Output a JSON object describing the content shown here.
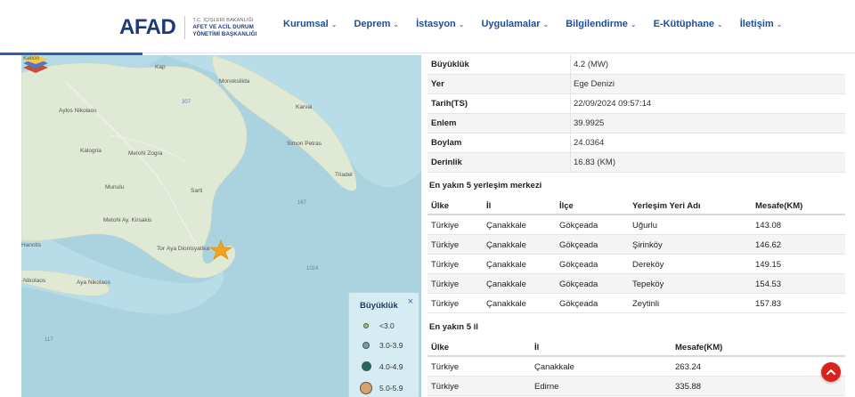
{
  "header": {
    "logo": "AFAD",
    "logo_lines": [
      "T.C. İÇİŞLERİ BAKANLIĞI",
      "AFET VE ACİL DURUM",
      "YÖNETİMİ BAŞKANLIĞI"
    ],
    "nav": [
      "Kurumsal",
      "Deprem",
      "İstasyon",
      "Uygulamalar",
      "Bilgilendirme",
      "E-Kütüphane",
      "İletişim"
    ]
  },
  "map": {
    "labels": {
      "kap": "Kap",
      "monoksilida": "Monoksilida",
      "karvai": "Karvai",
      "aylos": "Aylos Nikolaos",
      "kalogria": "Kalogria",
      "metohi_zogra": "Metohi Zogra",
      "simon_petras": "Simon Petras",
      "triadel": "Triadel",
      "munulu": "Munulu",
      "sarti": "Sarti",
      "metohi_ay": "Metohi Ay. Kirsakis",
      "hanotis": "Hanotis",
      "dionisyatika": "Aya Dionisyatika",
      "tor": "Tor",
      "nikolaos2": "-Nikolaos",
      "aya_nikolaos": "Aya Nikolaos",
      "kelion": "Kelion",
      "d307": "307",
      "d167": "167",
      "d1024": "1024",
      "d117": "117"
    },
    "legend": {
      "title": "Büyüklük",
      "close": "×",
      "items": [
        {
          "label": "<3.0",
          "color": "#8fce6a",
          "size": 6
        },
        {
          "label": "3.0-3.9",
          "color": "#6ea0a8",
          "size": 8
        },
        {
          "label": "4.0-4.9",
          "color": "#1d6b5a",
          "size": 11
        },
        {
          "label": "5.0-5.9",
          "color": "#d9a36c",
          "size": 14
        }
      ]
    }
  },
  "details": {
    "fields": [
      {
        "k": "Büyüklük",
        "v": "4.2 (MW)"
      },
      {
        "k": "Yer",
        "v": "Ege Denizi"
      },
      {
        "k": "Tarih(TS)",
        "v": "22/09/2024 09:57:14"
      },
      {
        "k": "Enlem",
        "v": "39.9925"
      },
      {
        "k": "Boylam",
        "v": "24.0364"
      },
      {
        "k": "Derinlik",
        "v": "16.83 (KM)"
      }
    ],
    "settlements_title": "En yakın 5 yerleşim merkezi",
    "settlements_headers": [
      "Ülke",
      "İl",
      "İlçe",
      "Yerleşim Yeri Adı",
      "Mesafe(KM)"
    ],
    "settlements": [
      [
        "Türkiye",
        "Çanakkale",
        "Gökçeada",
        "Uğurlu",
        "143.08"
      ],
      [
        "Türkiye",
        "Çanakkale",
        "Gökçeada",
        "Şirinköy",
        "146.62"
      ],
      [
        "Türkiye",
        "Çanakkale",
        "Gökçeada",
        "Dereköy",
        "149.15"
      ],
      [
        "Türkiye",
        "Çanakkale",
        "Gökçeada",
        "Tepeköy",
        "154.53"
      ],
      [
        "Türkiye",
        "Çanakkale",
        "Gökçeada",
        "Zeytinli",
        "157.83"
      ]
    ],
    "provinces_title": "En yakın 5 il",
    "provinces_headers": [
      "Ülke",
      "İl",
      "Mesafe(KM)"
    ],
    "provinces": [
      [
        "Türkiye",
        "Çanakkale",
        "263.24"
      ],
      [
        "Türkiye",
        "Edirne",
        "335.88"
      ]
    ]
  },
  "colors": {
    "brand": "#1b3a7a",
    "nav": "#1b4f9c",
    "sea": "#aad3df",
    "land": "#dfe9d3",
    "star": "#f2a21b",
    "scroll_top": "#d9221c"
  }
}
